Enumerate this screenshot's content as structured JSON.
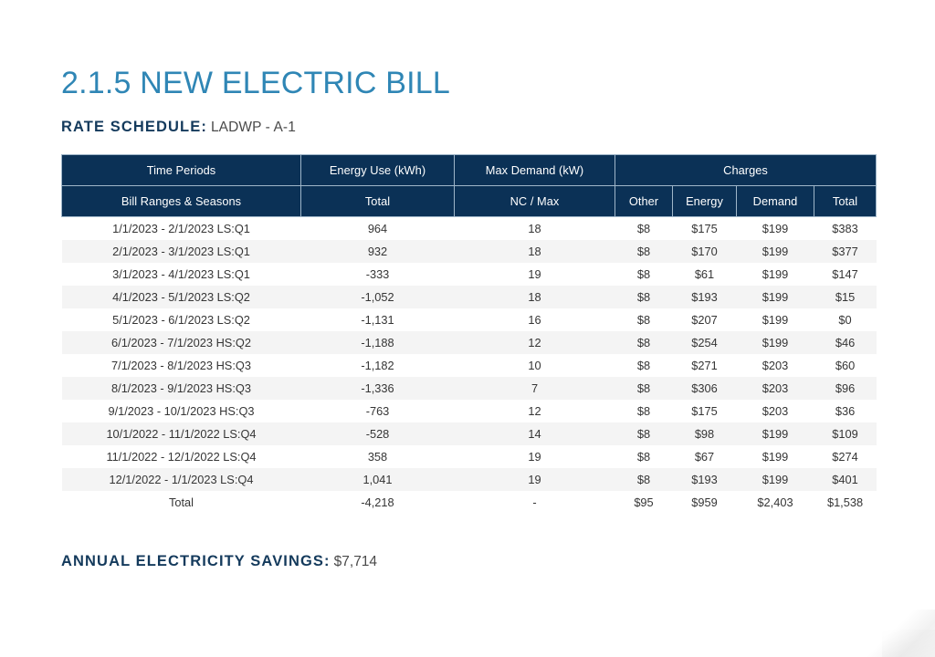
{
  "title": "2.1.5 NEW ELECTRIC BILL",
  "rate_schedule": {
    "label": "RATE SCHEDULE:",
    "value": "LADWP - A-1"
  },
  "savings": {
    "label": "ANNUAL ELECTRICITY SAVINGS:",
    "value": "$7,714"
  },
  "colors": {
    "title_blue": "#2f86b5",
    "header_navy": "#0b3156",
    "label_navy": "#143a5c",
    "negative_red": "#e02b26",
    "row_stripe": "#f4f4f4"
  },
  "table": {
    "header_row_1": [
      "Time Periods",
      "Energy Use (kWh)",
      "Max Demand (kW)",
      "Charges"
    ],
    "header_row_2": [
      "Bill Ranges & Seasons",
      "Total",
      "NC / Max",
      "Other",
      "Energy",
      "Demand",
      "Total"
    ],
    "rows": [
      {
        "period": "1/1/2023 - 2/1/2023 LS:Q1",
        "energy_use": "964",
        "energy_use_neg": false,
        "max_demand": "18",
        "other": "$8",
        "other_neg": false,
        "energy": "$175",
        "energy_neg": false,
        "demand": "$199",
        "demand_neg": false,
        "total": "$383",
        "total_neg": false
      },
      {
        "period": "2/1/2023 - 3/1/2023 LS:Q1",
        "energy_use": "932",
        "energy_use_neg": false,
        "max_demand": "18",
        "other": "$8",
        "other_neg": false,
        "energy": "$170",
        "energy_neg": false,
        "demand": "$199",
        "demand_neg": false,
        "total": "$377",
        "total_neg": false
      },
      {
        "period": "3/1/2023 - 4/1/2023 LS:Q1",
        "energy_use": "-333",
        "energy_use_neg": true,
        "max_demand": "19",
        "other": "$8",
        "other_neg": false,
        "energy": "$61",
        "energy_neg": true,
        "demand": "$199",
        "demand_neg": false,
        "total": "$147",
        "total_neg": false
      },
      {
        "period": "4/1/2023 - 5/1/2023 LS:Q2",
        "energy_use": "-1,052",
        "energy_use_neg": true,
        "max_demand": "18",
        "other": "$8",
        "other_neg": false,
        "energy": "$193",
        "energy_neg": true,
        "demand": "$199",
        "demand_neg": false,
        "total": "$15",
        "total_neg": false
      },
      {
        "period": "5/1/2023 - 6/1/2023 LS:Q2",
        "energy_use": "-1,131",
        "energy_use_neg": true,
        "max_demand": "16",
        "other": "$8",
        "other_neg": false,
        "energy": "$207",
        "energy_neg": true,
        "demand": "$199",
        "demand_neg": false,
        "total": "$0",
        "total_neg": false
      },
      {
        "period": "6/1/2023 - 7/1/2023 HS:Q2",
        "energy_use": "-1,188",
        "energy_use_neg": true,
        "max_demand": "12",
        "other": "$8",
        "other_neg": false,
        "energy": "$254",
        "energy_neg": true,
        "demand": "$199",
        "demand_neg": false,
        "total": "$46",
        "total_neg": true
      },
      {
        "period": "7/1/2023 - 8/1/2023 HS:Q3",
        "energy_use": "-1,182",
        "energy_use_neg": true,
        "max_demand": "10",
        "other": "$8",
        "other_neg": false,
        "energy": "$271",
        "energy_neg": true,
        "demand": "$203",
        "demand_neg": false,
        "total": "$60",
        "total_neg": true
      },
      {
        "period": "8/1/2023 - 9/1/2023 HS:Q3",
        "energy_use": "-1,336",
        "energy_use_neg": true,
        "max_demand": "7",
        "other": "$8",
        "other_neg": false,
        "energy": "$306",
        "energy_neg": true,
        "demand": "$203",
        "demand_neg": false,
        "total": "$96",
        "total_neg": true
      },
      {
        "period": "9/1/2023 - 10/1/2023 HS:Q3",
        "energy_use": "-763",
        "energy_use_neg": true,
        "max_demand": "12",
        "other": "$8",
        "other_neg": false,
        "energy": "$175",
        "energy_neg": true,
        "demand": "$203",
        "demand_neg": false,
        "total": "$36",
        "total_neg": false
      },
      {
        "period": "10/1/2022 - 11/1/2022 LS:Q4",
        "energy_use": "-528",
        "energy_use_neg": true,
        "max_demand": "14",
        "other": "$8",
        "other_neg": false,
        "energy": "$98",
        "energy_neg": true,
        "demand": "$199",
        "demand_neg": false,
        "total": "$109",
        "total_neg": false
      },
      {
        "period": "11/1/2022 - 12/1/2022 LS:Q4",
        "energy_use": "358",
        "energy_use_neg": false,
        "max_demand": "19",
        "other": "$8",
        "other_neg": false,
        "energy": "$67",
        "energy_neg": false,
        "demand": "$199",
        "demand_neg": false,
        "total": "$274",
        "total_neg": false
      },
      {
        "period": "12/1/2022 - 1/1/2023 LS:Q4",
        "energy_use": "1,041",
        "energy_use_neg": false,
        "max_demand": "19",
        "other": "$8",
        "other_neg": false,
        "energy": "$193",
        "energy_neg": false,
        "demand": "$199",
        "demand_neg": false,
        "total": "$401",
        "total_neg": false
      }
    ],
    "total_row": {
      "period": "Total",
      "energy_use": "-4,218",
      "energy_use_neg": true,
      "max_demand": "-",
      "other": "$95",
      "other_neg": false,
      "energy": "$959",
      "energy_neg": true,
      "demand": "$2,403",
      "demand_neg": false,
      "total": "$1,538",
      "total_neg": false
    }
  }
}
